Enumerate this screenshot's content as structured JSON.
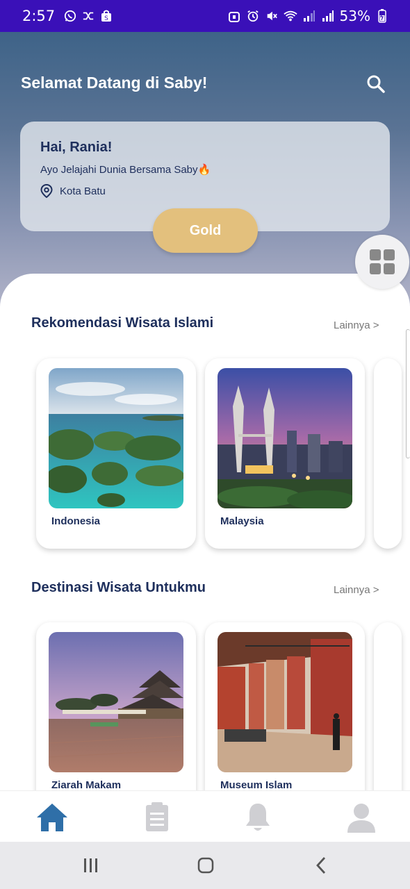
{
  "status_bar": {
    "time": "2:57",
    "battery": "53%",
    "left_icons": [
      "whatsapp-icon",
      "shuffle-icon",
      "shopping-bag-icon"
    ],
    "right_icons": [
      "lock-icon",
      "alarm-icon",
      "mute-icon",
      "wifi-icon",
      "signal-icon",
      "signal-icon",
      "battery-icon"
    ]
  },
  "header": {
    "title": "Selamat Datang di Saby!",
    "search_icon": "search-icon"
  },
  "greeting": {
    "name": "Hai, Rania!",
    "subtitle": "Ayo Jelajahi Dunia Bersama Saby🔥",
    "location": "Kota Batu",
    "tier": "Gold"
  },
  "sections": [
    {
      "title": "Rekomendasi Wisata Islami",
      "more": "Lainnya >",
      "cards": [
        {
          "label": "Indonesia"
        },
        {
          "label": "Malaysia"
        }
      ]
    },
    {
      "title": "Destinasi Wisata Untukmu",
      "more": "Lainnya >",
      "cards": [
        {
          "label": "Ziarah Makam"
        },
        {
          "label": "Museum Islam"
        }
      ]
    }
  ],
  "bottom_nav": [
    {
      "icon": "home-icon",
      "active": true
    },
    {
      "icon": "clipboard-icon",
      "active": false
    },
    {
      "icon": "bell-icon",
      "active": false
    },
    {
      "icon": "profile-icon",
      "active": false
    }
  ],
  "colors": {
    "status_bar": "#3a10b8",
    "primary_text": "#1e2f5c",
    "gold": "#e3c07d",
    "nav_active": "#2f6fa8",
    "nav_inactive": "#cfcfd3"
  }
}
